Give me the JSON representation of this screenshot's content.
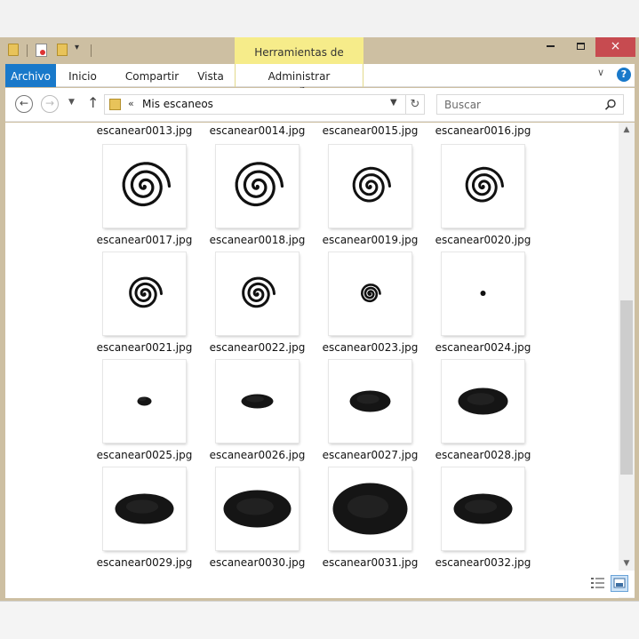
{
  "ribbon": {
    "context_tab": "Herramientas de imagen",
    "tabs": [
      "Archivo",
      "Inicio",
      "Compartir",
      "Vista",
      "Administrar"
    ]
  },
  "window_controls": {
    "minimize": "minimize",
    "maximize": "maximize",
    "close": "×"
  },
  "help_label": "?",
  "address": {
    "chevrons": "«",
    "path": "Mis escaneos"
  },
  "search": {
    "placeholder": "Buscar"
  },
  "top_row_labels": [
    "escanear0013.jpg",
    "escanear0014.jpg",
    "escanear0015.jpg",
    "escanear0016.jpg"
  ],
  "files": [
    {
      "name": "escanear0017.jpg",
      "thumb": "spiral-large"
    },
    {
      "name": "escanear0018.jpg",
      "thumb": "spiral-large"
    },
    {
      "name": "escanear0019.jpg",
      "thumb": "spiral-medium"
    },
    {
      "name": "escanear0020.jpg",
      "thumb": "spiral-medium"
    },
    {
      "name": "escanear0021.jpg",
      "thumb": "spiral-small"
    },
    {
      "name": "escanear0022.jpg",
      "thumb": "spiral-small"
    },
    {
      "name": "escanear0023.jpg",
      "thumb": "spiral-tiny"
    },
    {
      "name": "escanear0024.jpg",
      "thumb": "dot"
    },
    {
      "name": "escanear0025.jpg",
      "thumb": "blob-1"
    },
    {
      "name": "escanear0026.jpg",
      "thumb": "blob-2"
    },
    {
      "name": "escanear0027.jpg",
      "thumb": "blob-3"
    },
    {
      "name": "escanear0028.jpg",
      "thumb": "blob-4"
    },
    {
      "name": "escanear0029.jpg",
      "thumb": "blob-5"
    },
    {
      "name": "escanear0030.jpg",
      "thumb": "blob-6"
    },
    {
      "name": "escanear0031.jpg",
      "thumb": "blob-7"
    },
    {
      "name": "escanear0032.jpg",
      "thumb": "blob-5"
    }
  ],
  "colors": {
    "archivo_tab": "#1979ca",
    "context_tab": "#f6ec8a",
    "close_button": "#c74b50",
    "window_frame": "#cdbfa2"
  }
}
